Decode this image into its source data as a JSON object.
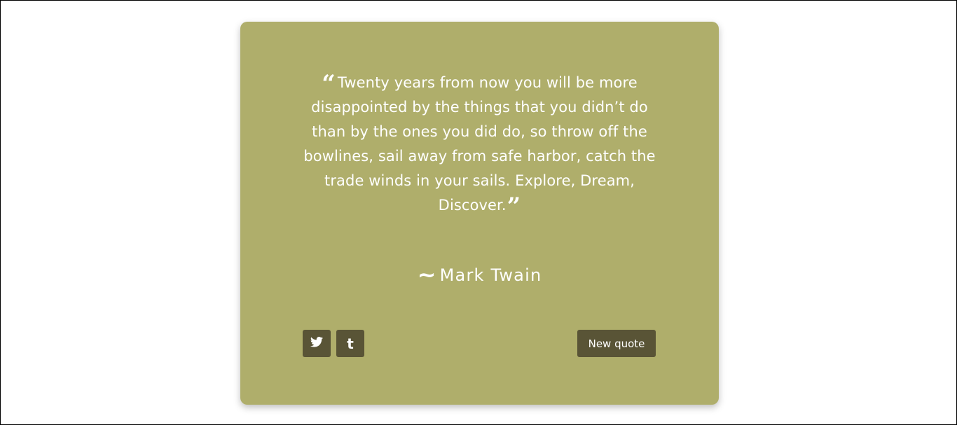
{
  "colors": {
    "page_background": "#ffffff",
    "card_background": "#afae6b",
    "button_background": "#595436",
    "text": "#ffffff"
  },
  "quote": {
    "open_mark": "“",
    "text": "Twenty years from now you will be more disappointed by the things that you didn’t do than by the ones you did do, so throw off the bowlines, sail away from safe harbor, catch the trade winds in your sails. Explore, Dream, Discover.",
    "close_mark": "”"
  },
  "author": {
    "prefix": "~",
    "name": "Mark Twain"
  },
  "actions": {
    "twitter_icon": "twitter-icon",
    "tumblr_icon": "tumblr-icon",
    "tumblr_glyph": "t",
    "new_quote_label": "New quote"
  }
}
